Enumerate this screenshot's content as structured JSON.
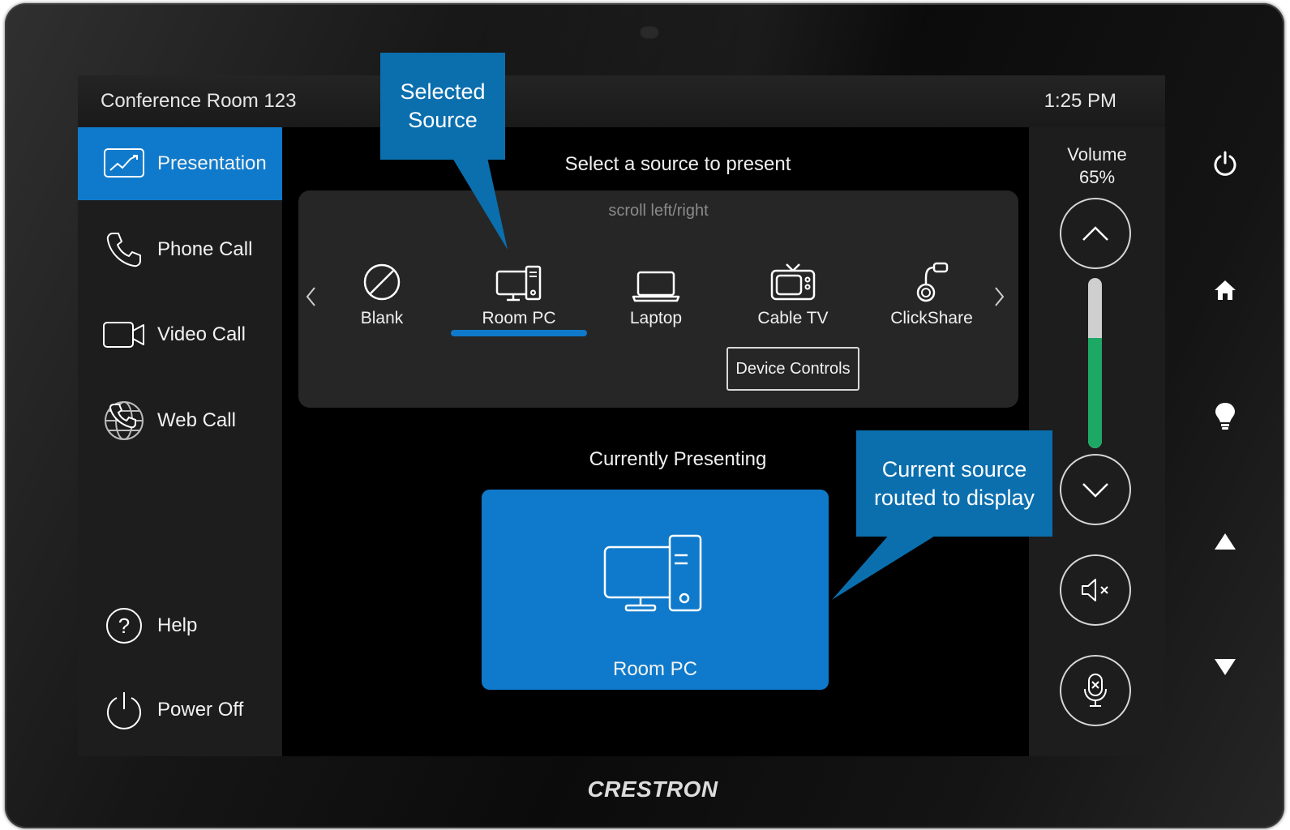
{
  "header": {
    "room_name": "Conference Room 123",
    "time": "1:25 PM"
  },
  "sidebar": {
    "items": [
      {
        "label": "Presentation",
        "icon": "presentation-icon",
        "active": true
      },
      {
        "label": "Phone Call",
        "icon": "phone-icon",
        "active": false
      },
      {
        "label": "Video Call",
        "icon": "video-camera-icon",
        "active": false
      },
      {
        "label": "Web Call",
        "icon": "globe-phone-icon",
        "active": false
      }
    ],
    "bottom_items": [
      {
        "label": "Help",
        "icon": "help-icon"
      },
      {
        "label": "Power Off",
        "icon": "power-icon"
      }
    ]
  },
  "main": {
    "prompt": "Select a source to present",
    "scroll_hint": "scroll left/right",
    "sources": [
      {
        "label": "Blank",
        "icon": "blank-icon"
      },
      {
        "label": "Room PC",
        "icon": "desktop-pc-icon",
        "selected": true
      },
      {
        "label": "Laptop",
        "icon": "laptop-icon"
      },
      {
        "label": "Cable TV",
        "icon": "tv-icon"
      },
      {
        "label": "ClickShare",
        "icon": "clickshare-icon"
      }
    ],
    "device_controls_label": "Device Controls",
    "currently_presenting_title": "Currently Presenting",
    "currently_presenting_source": "Room PC"
  },
  "volume": {
    "label": "Volume",
    "level_text": "65%",
    "level": 0.65
  },
  "hard_buttons": [
    "power-icon",
    "home-icon",
    "lightbulb-icon",
    "up-triangle-icon",
    "down-triangle-icon"
  ],
  "callouts": {
    "selected_source": "Selected Source",
    "current_source": "Current source routed to display"
  },
  "brand": "CRESTRON",
  "colors": {
    "accent": "#0f7acb",
    "volume_fill": "#1ea866",
    "callout": "#0b6fae"
  }
}
